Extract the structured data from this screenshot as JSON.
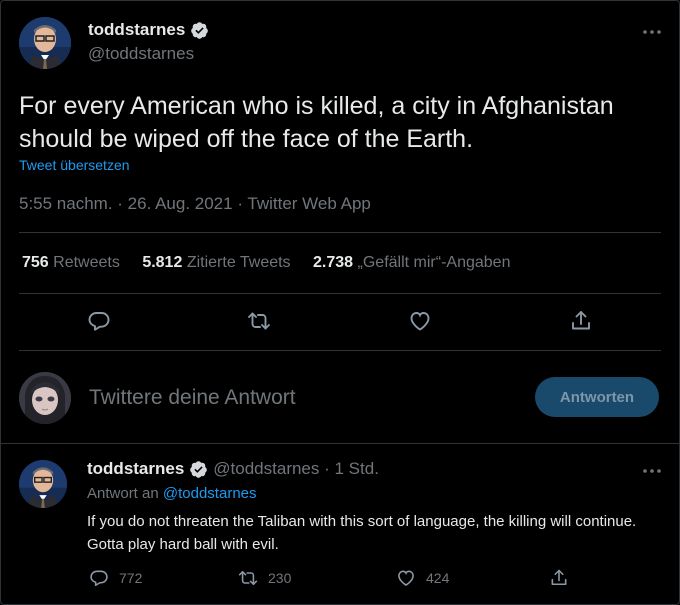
{
  "main_tweet": {
    "author_name": "toddstarnes",
    "author_handle": "@toddstarnes",
    "text": "For every American who is killed, a city in Afghanistan should be wiped off the face of the Earth.",
    "translate_link": "Tweet übersetzen",
    "meta": "5:55 nachm. · 26. Aug. 2021 · Twitter Web App",
    "stats": {
      "retweets_count": "756",
      "retweets_label": "Retweets",
      "quotes_count": "5.812",
      "quotes_label": "Zitierte Tweets",
      "likes_count": "2.738",
      "likes_label": "„Gefällt mir“-Angaben"
    }
  },
  "reply_box": {
    "placeholder": "Twittere deine Antwort",
    "button_label": "Antworten"
  },
  "reply_tweet": {
    "author_name": "toddstarnes",
    "author_handle_time": "@toddstarnes · 1 Std.",
    "reply_to_prefix": "Antwort an",
    "reply_to_handle": "@toddstarnes",
    "text": "If you do not threaten the Taliban with this sort of language, the killing will continue. Gotta play hard ball with evil.",
    "replies": "772",
    "retweets": "230",
    "likes": "424"
  },
  "colors": {
    "background": "#000000",
    "accent": "#1d9bf0",
    "muted": "#71767b",
    "divider": "#2f3336"
  },
  "icons": [
    "verified-badge-icon",
    "more-icon",
    "reply-icon",
    "retweet-icon",
    "like-icon",
    "share-icon"
  ]
}
